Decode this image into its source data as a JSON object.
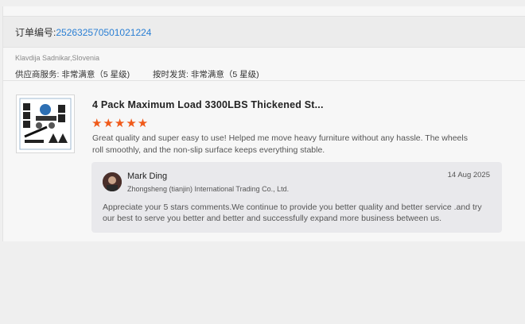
{
  "order": {
    "label": "订单编号:",
    "number": "252632570501021224"
  },
  "buyer": {
    "name_location": "Klavdija Sadnikar,Slovenia"
  },
  "ratings": {
    "supplier_service": "供应商服务: 非常满意（5 星级)",
    "on_time_delivery": "按时发货: 非常满意（5 星级)"
  },
  "product": {
    "title": "4 Pack Maximum Load 3300LBS Thickened St...",
    "stars": "★★★★★",
    "rating": 5
  },
  "review": {
    "text": "Great quality and super easy to use! Helped me move heavy furniture without any hassle. The wheels roll smoothly, and the non-slip surface keeps everything stable."
  },
  "reply": {
    "seller_name": "Mark Ding",
    "company": "Zhongsheng (tianjin) International Trading Co., Ltd.",
    "date": "14 Aug 2025",
    "text": "Appreciate your 5 stars comments.We continue to provide you better quality and better service .and try  our best to serve you better and better and successfully expand more business between us."
  },
  "colors": {
    "accent_link": "#2a7fd4",
    "star": "#f05a1a"
  }
}
